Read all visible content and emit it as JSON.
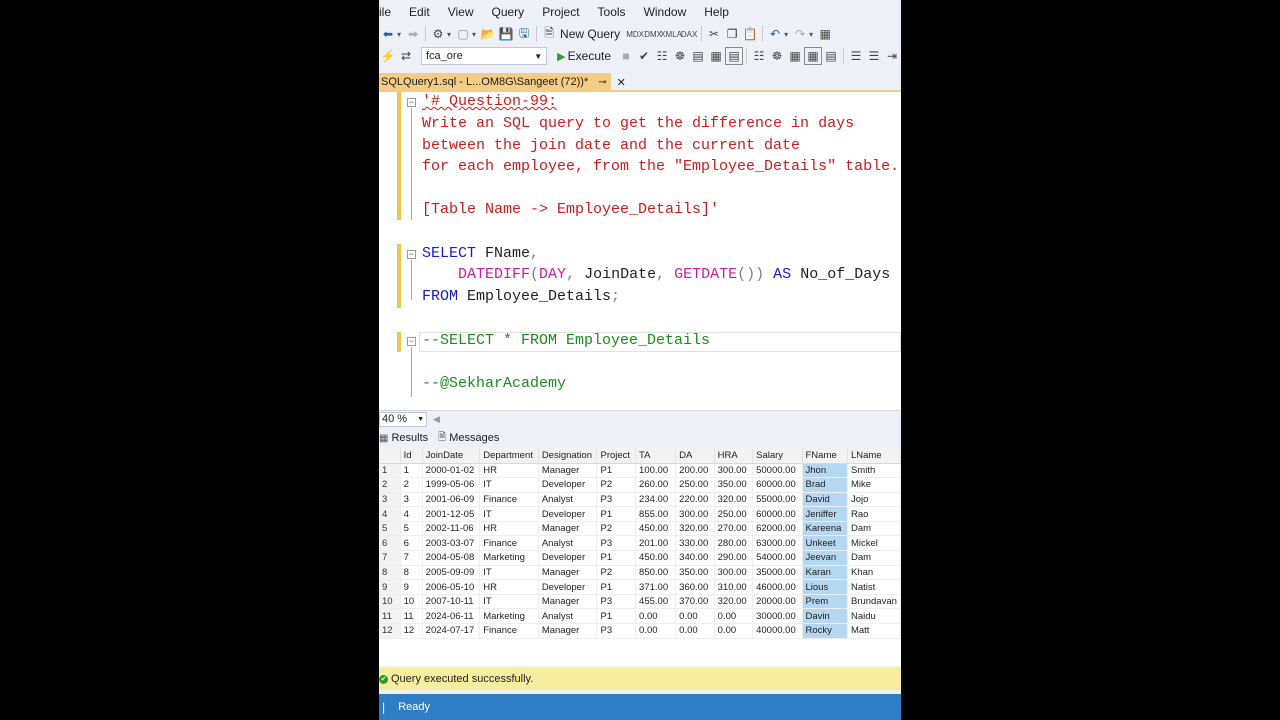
{
  "menu": [
    "ile",
    "Edit",
    "View",
    "Query",
    "Project",
    "Tools",
    "Window",
    "Help"
  ],
  "toolbar": {
    "new_query_label": "New Query",
    "database": "fca_ore",
    "execute_label": "Execute"
  },
  "tab": {
    "title": "SQLQuery1.sql - L...OM8G\\Sangeet (72))*",
    "pin": "⊸",
    "close": "✕"
  },
  "editor": {
    "lines": [
      "'# Question-99:",
      "Write an SQL query to get the difference in days",
      "between the join date and the current date",
      "for each employee, from the \"Employee_Details\" table.",
      "[Table Name -> Employee_Details]'",
      "SELECT FName,",
      "    DATEDIFF(DAY, JoinDate, GETDATE()) AS No_of_Days",
      "FROM Employee_Details;",
      "--SELECT * FROM Employee_Details",
      "--@SekharAcademy"
    ]
  },
  "zoom": "40 %",
  "results_tabs": {
    "results": "Results",
    "messages": "Messages"
  },
  "grid": {
    "columns": [
      "",
      "Id",
      "JoinDate",
      "Department",
      "Designation",
      "Project",
      "TA",
      "DA",
      "HRA",
      "Salary",
      "FName",
      "LName"
    ],
    "rows": [
      [
        "1",
        "1",
        "2000-01-02",
        "HR",
        "Manager",
        "P1",
        "100.00",
        "200.00",
        "300.00",
        "50000.00",
        "Jhon",
        "Smith"
      ],
      [
        "2",
        "2",
        "1999-05-06",
        "IT",
        "Developer",
        "P2",
        "260.00",
        "250.00",
        "350.00",
        "60000.00",
        "Brad",
        "Mike"
      ],
      [
        "3",
        "3",
        "2001-06-09",
        "Finance",
        "Analyst",
        "P3",
        "234.00",
        "220.00",
        "320.00",
        "55000.00",
        "David",
        "Jojo"
      ],
      [
        "4",
        "4",
        "2001-12-05",
        "IT",
        "Developer",
        "P1",
        "855.00",
        "300.00",
        "250.00",
        "60000.00",
        "Jeniffer",
        "Rao"
      ],
      [
        "5",
        "5",
        "2002-11-06",
        "HR",
        "Manager",
        "P2",
        "450.00",
        "320.00",
        "270.00",
        "62000.00",
        "Kareena",
        "Dam"
      ],
      [
        "6",
        "6",
        "2003-03-07",
        "Finance",
        "Analyst",
        "P3",
        "201.00",
        "330.00",
        "280.00",
        "63000.00",
        "Unkeet",
        "Mickel"
      ],
      [
        "7",
        "7",
        "2004-05-08",
        "Marketing",
        "Developer",
        "P1",
        "450.00",
        "340.00",
        "290.00",
        "54000.00",
        "Jeevan",
        "Dam"
      ],
      [
        "8",
        "8",
        "2005-09-09",
        "IT",
        "Manager",
        "P2",
        "850.00",
        "350.00",
        "300.00",
        "35000.00",
        "Karan",
        "Khan"
      ],
      [
        "9",
        "9",
        "2006-05-10",
        "HR",
        "Developer",
        "P1",
        "371.00",
        "360.00",
        "310.00",
        "46000.00",
        "Lious",
        "Natist"
      ],
      [
        "10",
        "10",
        "2007-10-11",
        "IT",
        "Manager",
        "P3",
        "455.00",
        "370.00",
        "320.00",
        "20000.00",
        "Prem",
        "Brundavan"
      ],
      [
        "11",
        "11",
        "2024-06-11",
        "Marketing",
        "Analyst",
        "P1",
        "0.00",
        "0.00",
        "0.00",
        "30000.00",
        "Davin",
        "Naidu"
      ],
      [
        "12",
        "12",
        "2024-07-17",
        "Finance",
        "Manager",
        "P3",
        "0.00",
        "0.00",
        "0.00",
        "40000.00",
        "Rocky",
        "Matt"
      ]
    ]
  },
  "status": {
    "exec_message": "Query executed successfully.",
    "ready": "Ready"
  },
  "colors": {
    "tab_active": "#f5cc84",
    "status_bar": "#2e7dc5",
    "exec_bar": "#f7ed9e",
    "selected_cell": "#b6d7f1"
  }
}
